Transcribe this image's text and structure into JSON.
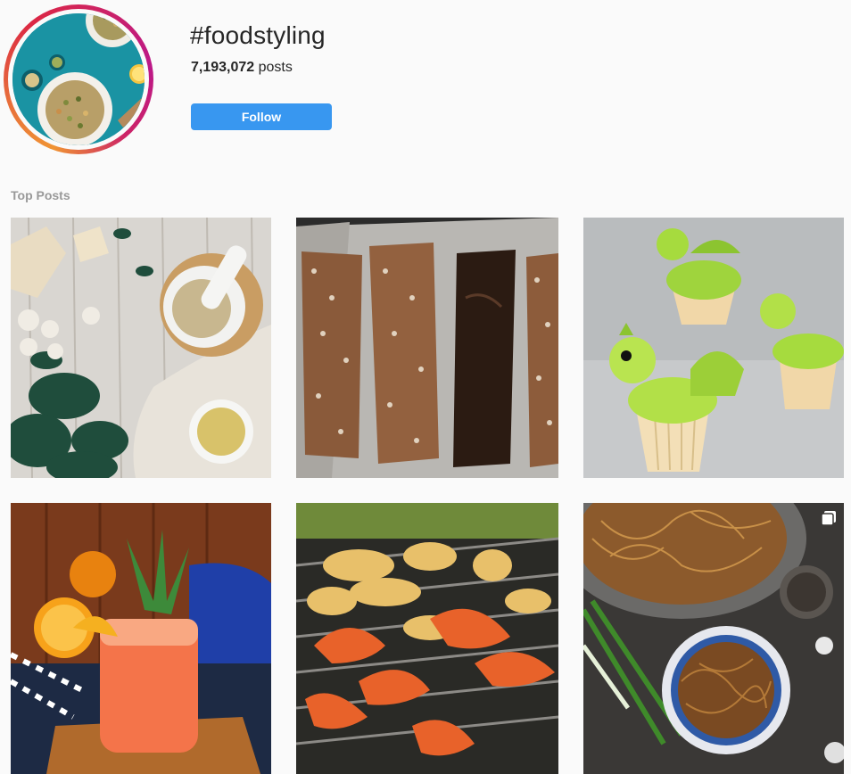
{
  "hashtag": {
    "title": "#foodstyling",
    "post_count": "7,193,072",
    "post_count_suffix": " posts",
    "follow_label": "Follow"
  },
  "top_posts": {
    "label": "Top Posts",
    "posts": [
      {
        "subject": "basil, garlic, mortar and pestle"
      },
      {
        "subject": "crispy puffed grain bars with chocolate"
      },
      {
        "subject": "green dragon cupcakes"
      },
      {
        "subject": "pineapple orange cocktail"
      },
      {
        "subject": "grilled shrimp and chicken"
      },
      {
        "subject": "noodles in bowl and wok",
        "multiple": true
      }
    ]
  },
  "colors": {
    "follow_button": "#3897f0",
    "section_label": "#999999",
    "background": "#fafafa"
  }
}
